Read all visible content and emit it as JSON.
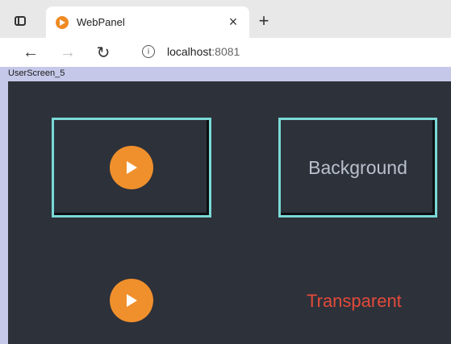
{
  "browser": {
    "tab": {
      "title": "WebPanel",
      "close_glyph": "×",
      "favicon": "play-favicon-icon"
    },
    "new_tab_glyph": "+",
    "nav": {
      "back_glyph": "←",
      "forward_glyph": "→",
      "reload_glyph": "↻"
    },
    "address": {
      "host": "localhost",
      "port": ":8081",
      "info_glyph": "i"
    }
  },
  "page": {
    "screen_label": "UserScreen_5",
    "background_color": "#2d313a",
    "tiles": [
      {
        "kind": "play-button",
        "framed": true
      },
      {
        "kind": "text",
        "framed": true,
        "label": "Background",
        "color": "#b9c0cc"
      },
      {
        "kind": "play-button",
        "framed": false
      },
      {
        "kind": "text",
        "framed": false,
        "label": "Transparent",
        "color": "#e34a3a"
      }
    ],
    "accent_colors": {
      "frame": "#7ad9d6",
      "play": "#f0902c"
    }
  }
}
